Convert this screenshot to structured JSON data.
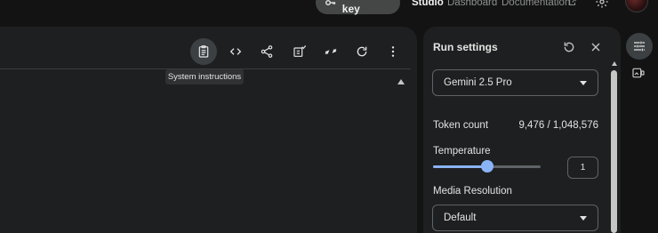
{
  "header": {
    "api_key_label": "Get API key",
    "studio_label": "Studio",
    "dashboard_label": "Dashboard",
    "documentation_label": "Documentation"
  },
  "toolbar": {
    "tooltip": "System instructions",
    "icons": [
      "system-instructions-icon",
      "code-icon",
      "share-icon",
      "compare-icon",
      "compress-icon",
      "refresh-icon",
      "more-vert-icon"
    ]
  },
  "run_settings": {
    "title": "Run settings",
    "model": "Gemini 2.5 Pro",
    "token_count_label": "Token count",
    "token_count_value": "9,476 / 1,048,576",
    "temperature_label": "Temperature",
    "temperature_value": "1",
    "temperature_fraction": 0.5,
    "media_resolution_label": "Media Resolution",
    "media_resolution_value": "Default"
  },
  "colors": {
    "accent": "#8ab4f8",
    "surface": "#1e1f20",
    "background": "#131313"
  }
}
